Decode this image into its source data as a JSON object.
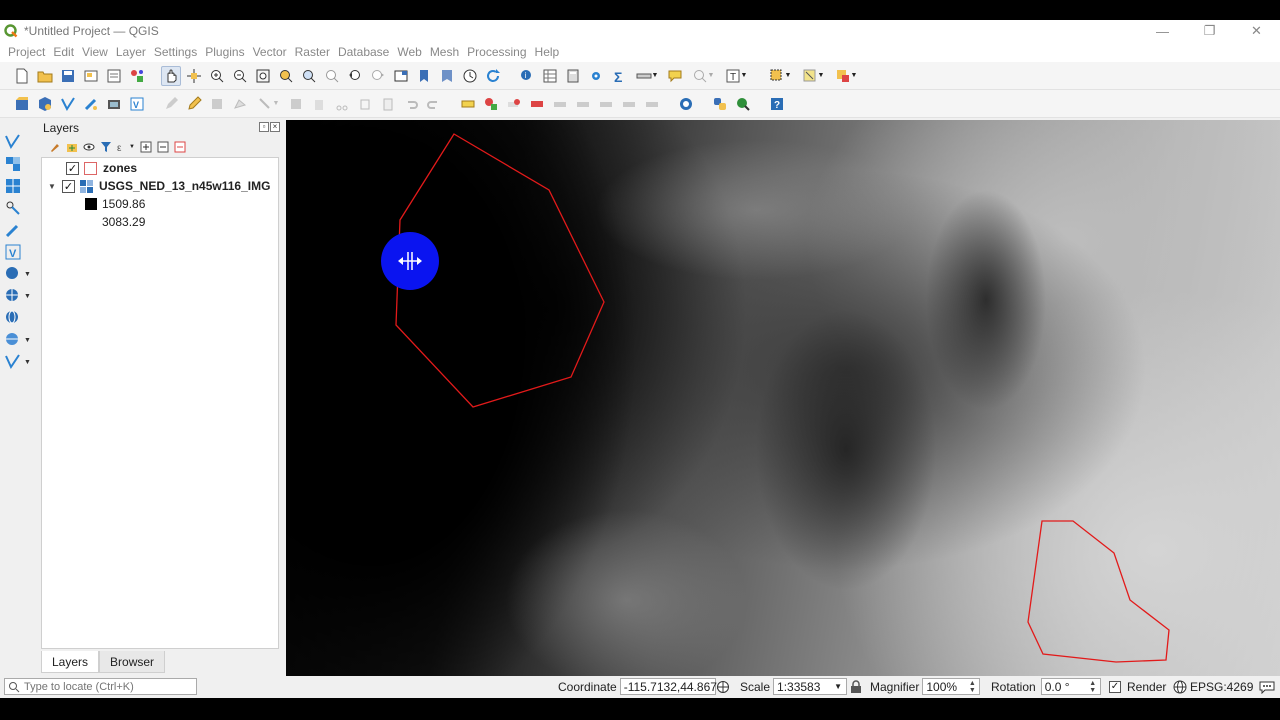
{
  "window": {
    "title": "*Untitled Project — QGIS",
    "controls": {
      "minimize": "—",
      "restore": "❐",
      "close": "✕"
    }
  },
  "menu": [
    "Project",
    "Edit",
    "View",
    "Layer",
    "Settings",
    "Plugins",
    "Vector",
    "Raster",
    "Database",
    "Web",
    "Mesh",
    "Processing",
    "Help"
  ],
  "layers_panel": {
    "title": "Layers",
    "tabs": {
      "layers": "Layers",
      "browser": "Browser"
    },
    "layers": [
      {
        "name": "zones",
        "checked": true,
        "check_mark": "✓"
      },
      {
        "name": "USGS_NED_13_n45w116_IMG",
        "checked": true,
        "check_mark": "✓",
        "expand": "▼",
        "legend": {
          "min": "1509.86",
          "max": "3083.29"
        }
      }
    ]
  },
  "status": {
    "locator_placeholder": "Type to locate (Ctrl+K)",
    "coordinate_label": "Coordinate",
    "coordinate_value": "-115.7132,44.8674",
    "scale_label": "Scale",
    "scale_value": "1:33583",
    "magnifier_label": "Magnifier",
    "magnifier_value": "100%",
    "rotation_label": "Rotation",
    "rotation_value": "0.0 °",
    "render_label": "Render",
    "render_check": "✓",
    "crs": "EPSG:4269"
  },
  "colors": {
    "zone_outline": "#e21a1a",
    "cursor_highlight": "#0a14f0",
    "accent": "#2a6db5"
  }
}
